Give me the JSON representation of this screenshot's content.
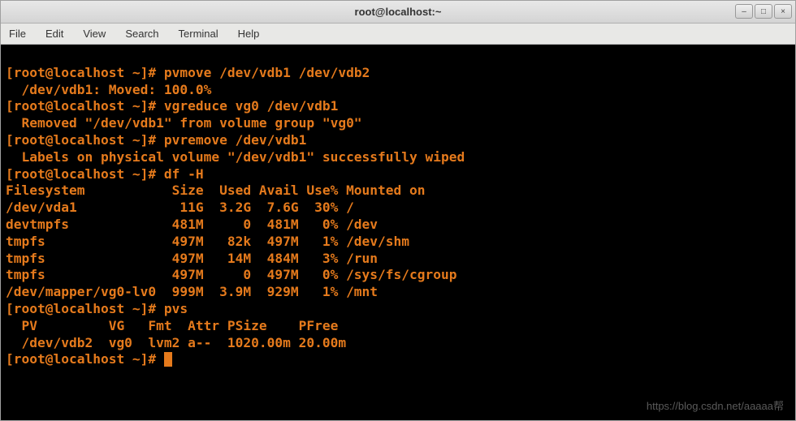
{
  "window": {
    "title": "root@localhost:~",
    "minimize": "–",
    "maximize": "□",
    "close": "×"
  },
  "menubar": {
    "file": "File",
    "edit": "Edit",
    "view": "View",
    "search": "Search",
    "terminal": "Terminal",
    "help": "Help"
  },
  "terminal": {
    "prompt": "[root@localhost ~]# ",
    "cmd1": "pvmove /dev/vdb1 /dev/vdb2",
    "out1": "  /dev/vdb1: Moved: 100.0%",
    "cmd2": "vgreduce vg0 /dev/vdb1",
    "out2": "  Removed \"/dev/vdb1\" from volume group \"vg0\"",
    "cmd3": "pvremove /dev/vdb1",
    "out3": "  Labels on physical volume \"/dev/vdb1\" successfully wiped",
    "cmd4": "df -H",
    "dfhdr": "Filesystem           Size  Used Avail Use% Mounted on",
    "dfrows": [
      "/dev/vda1             11G  3.2G  7.6G  30% /",
      "devtmpfs             481M     0  481M   0% /dev",
      "tmpfs                497M   82k  497M   1% /dev/shm",
      "tmpfs                497M   14M  484M   3% /run",
      "tmpfs                497M     0  497M   0% /sys/fs/cgroup",
      "/dev/mapper/vg0-lv0  999M  3.9M  929M   1% /mnt"
    ],
    "cmd5": "pvs",
    "pvshdr": "  PV         VG   Fmt  Attr PSize    PFree ",
    "pvsrows": [
      "  /dev/vdb2  vg0  lvm2 a--  1020.00m 20.00m"
    ]
  },
  "watermark": "https://blog.csdn.net/aaaaa帮"
}
